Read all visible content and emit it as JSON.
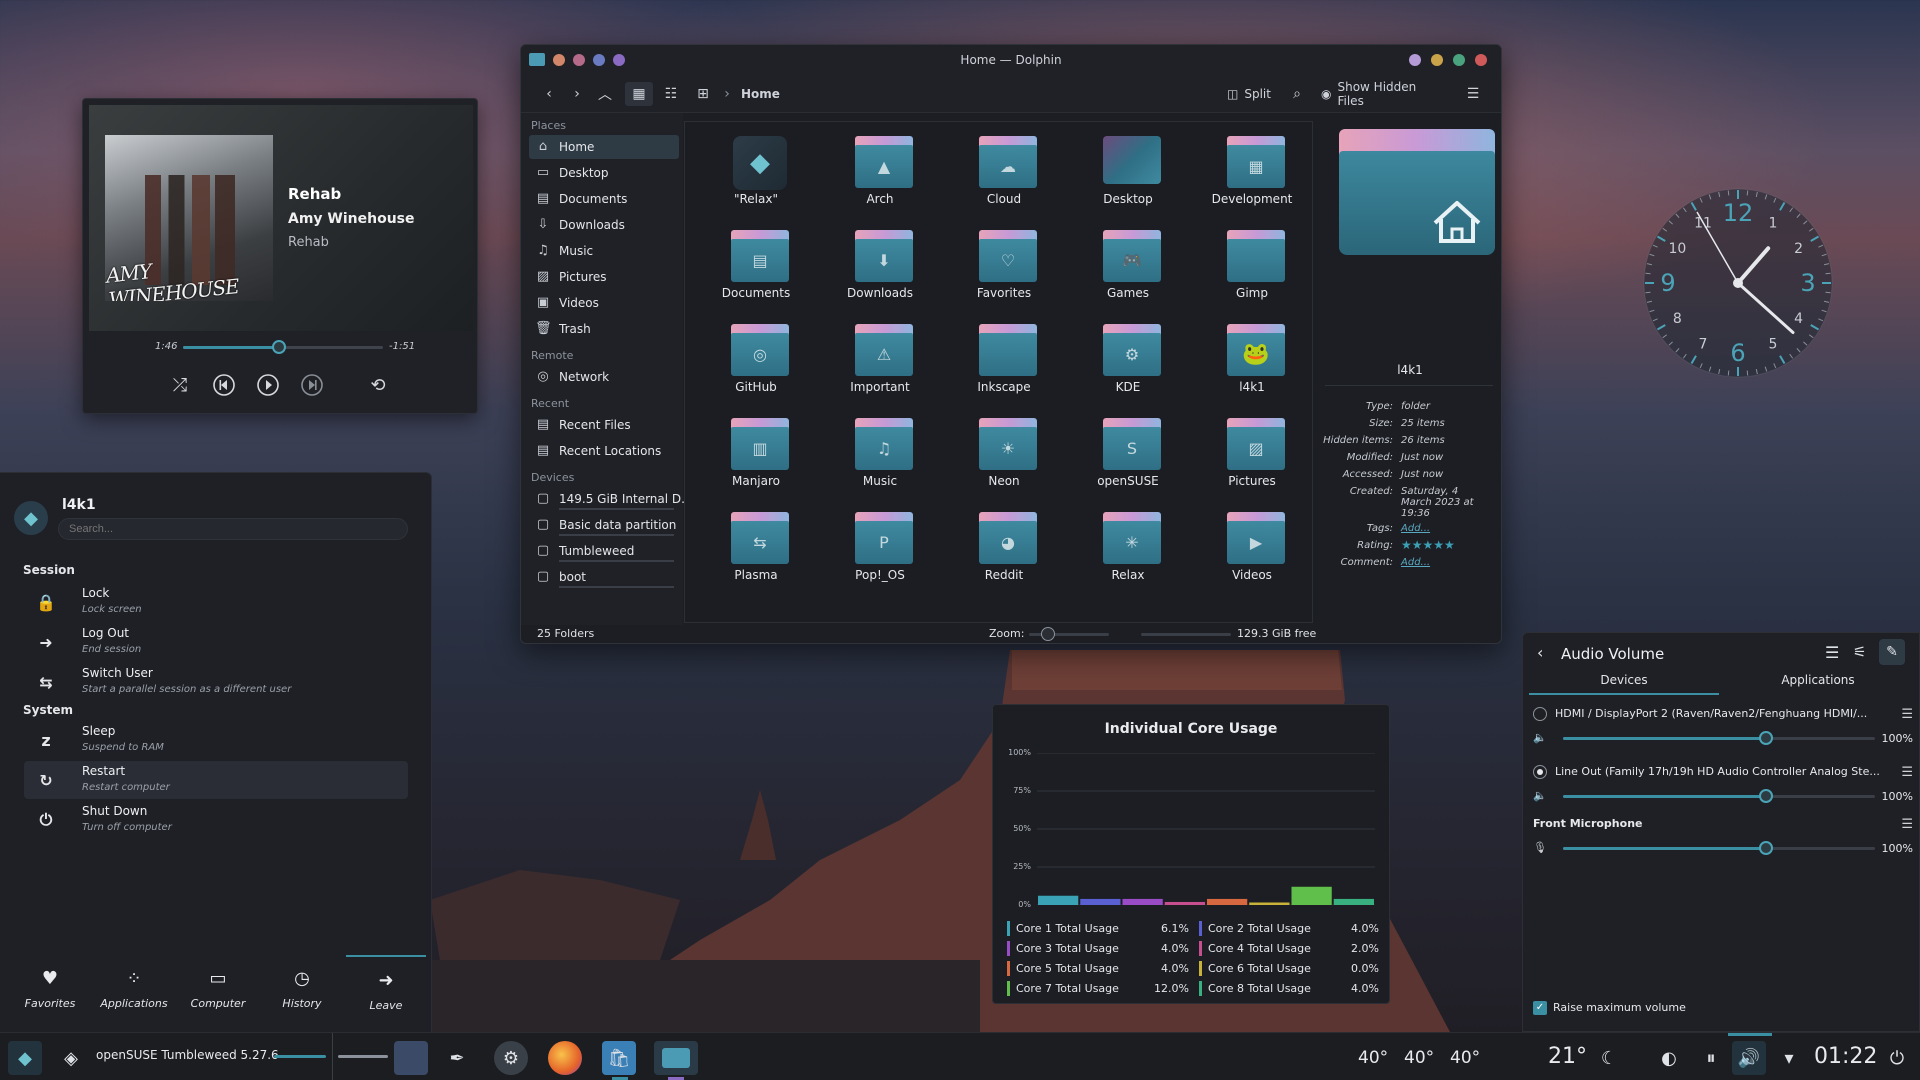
{
  "media_player": {
    "title": "Rehab",
    "artist": "Amy Winehouse",
    "album": "Rehab",
    "cover_text": "AMY WINEHOUSE",
    "elapsed": "1:46",
    "remaining": "-1:51",
    "progress": 0.48,
    "icons": [
      "shuffle-icon",
      "previous-icon",
      "play-icon",
      "next-icon",
      "repeat-icon"
    ]
  },
  "launcher": {
    "username": "l4k1",
    "search_placeholder": "Search...",
    "session_header": "Session",
    "system_header": "System",
    "session_items": [
      {
        "name": "Lock",
        "desc": "Lock screen",
        "icon": "lock-icon"
      },
      {
        "name": "Log Out",
        "desc": "End session",
        "icon": "logout-icon"
      },
      {
        "name": "Switch User",
        "desc": "Start a parallel session as a different user",
        "icon": "switch-user-icon"
      }
    ],
    "system_items": [
      {
        "name": "Sleep",
        "desc": "Suspend to RAM",
        "icon": "sleep-icon"
      },
      {
        "name": "Restart",
        "desc": "Restart computer",
        "icon": "restart-icon"
      },
      {
        "name": "Shut Down",
        "desc": "Turn off computer",
        "icon": "power-icon"
      }
    ],
    "tabs": [
      {
        "label": "Favorites",
        "icon": "heart-icon"
      },
      {
        "label": "Applications",
        "icon": "apps-icon"
      },
      {
        "label": "Computer",
        "icon": "computer-icon"
      },
      {
        "label": "History",
        "icon": "clock-icon"
      },
      {
        "label": "Leave",
        "icon": "arrow-right-icon"
      }
    ]
  },
  "dolphin": {
    "window_title": "Home — Dolphin",
    "breadcrumb": "Home",
    "split_label": "Split",
    "hidden_files_label": "Show Hidden Files",
    "places": {
      "places_header": "Places",
      "remote_header": "Remote",
      "recent_header": "Recent",
      "devices_header": "Devices",
      "places_items": [
        "Home",
        "Desktop",
        "Documents",
        "Downloads",
        "Music",
        "Pictures",
        "Videos",
        "Trash"
      ],
      "remote_items": [
        "Network"
      ],
      "recent_items": [
        "Recent Files",
        "Recent Locations"
      ],
      "device_items": [
        "149.5 GiB Internal D...",
        "Basic data partition",
        "Tumbleweed",
        "boot"
      ]
    },
    "folders": [
      "\"Relax\"",
      "Arch",
      "Cloud",
      "Desktop",
      "Development",
      "Documents",
      "Downloads",
      "Favorites",
      "Games",
      "Gimp",
      "GitHub",
      "Important",
      "Inkscape",
      "KDE",
      "l4k1",
      "Manjaro",
      "Music",
      "Neon",
      "openSUSE",
      "Pictures",
      "Plasma",
      "Pop!_OS",
      "Reddit",
      "Relax",
      "Videos"
    ],
    "folder_glyphs": [
      "",
      "▲",
      "☁",
      "",
      "▦",
      "▤",
      "⬇",
      "♡",
      "🎮",
      "",
      "◎",
      "⚠",
      "",
      "⚙",
      "",
      "▥",
      "♫",
      "☀",
      "S",
      "▨",
      "⇆",
      "P",
      "◕",
      "✳",
      "▶"
    ],
    "info": {
      "name": "l4k1",
      "rows": [
        {
          "k": "Type:",
          "v": "folder"
        },
        {
          "k": "Size:",
          "v": "25 items"
        },
        {
          "k": "Hidden items:",
          "v": "26 items"
        },
        {
          "k": "Modified:",
          "v": "Just now"
        },
        {
          "k": "Accessed:",
          "v": "Just now"
        },
        {
          "k": "Created:",
          "v": "Saturday, 4 March 2023 at 19:36"
        }
      ],
      "tags_k": "Tags:",
      "tags_v": "Add...",
      "rating_k": "Rating:",
      "rating_v": "★★★★★",
      "comment_k": "Comment:",
      "comment_v": "Add..."
    },
    "status_count": "25 Folders",
    "zoom_label": "Zoom:",
    "free_space": "129.3 GiB free"
  },
  "core_widget": {
    "title": "Individual Core Usage"
  },
  "chart_data": {
    "type": "bar",
    "title": "Individual Core Usage",
    "categories": [
      "Core 1 Total Usage",
      "Core 2 Total Usage",
      "Core 3 Total Usage",
      "Core 4 Total Usage",
      "Core 5 Total Usage",
      "Core 6 Total Usage",
      "Core 7 Total Usage",
      "Core 8 Total Usage"
    ],
    "values": [
      6.1,
      4.0,
      4.0,
      2.0,
      4.0,
      0.0,
      12.0,
      4.0
    ],
    "value_labels": [
      "6.1%",
      "4.0%",
      "4.0%",
      "2.0%",
      "4.0%",
      "0.0%",
      "12.0%",
      "4.0%"
    ],
    "colors": [
      "#3aa3b5",
      "#5a5fd1",
      "#9a4cc6",
      "#c84f8f",
      "#d8683f",
      "#c9b23a",
      "#5fbf4a",
      "#38b07f"
    ],
    "yticks": [
      "0%",
      "25%",
      "50%",
      "75%",
      "100%"
    ],
    "ylim": [
      0,
      100
    ]
  },
  "clock": {
    "hours": 1,
    "minutes": 22,
    "numerals": [
      "12",
      "1",
      "2",
      "3",
      "4",
      "5",
      "6",
      "7",
      "8",
      "9",
      "10",
      "11"
    ]
  },
  "audio": {
    "title": "Audio Volume",
    "tabs": [
      "Devices",
      "Applications"
    ],
    "devices": [
      {
        "name": "HDMI / DisplayPort 2 (Raven/Raven2/Fenghuang HDMI/...",
        "volume": "100%",
        "selected": false
      },
      {
        "name": "Line Out (Family 17h/19h HD Audio Controller Analog Ste...",
        "volume": "100%",
        "selected": true
      }
    ],
    "mic_name": "Front Microphone",
    "mic_volume": "100%",
    "raise_max_label": "Raise maximum volume"
  },
  "taskbar": {
    "distro_label": "openSUSE Tumbleweed 5.27.6",
    "temps": [
      "40°",
      "40°",
      "40°"
    ],
    "weather": "21°",
    "time": "01:22"
  }
}
